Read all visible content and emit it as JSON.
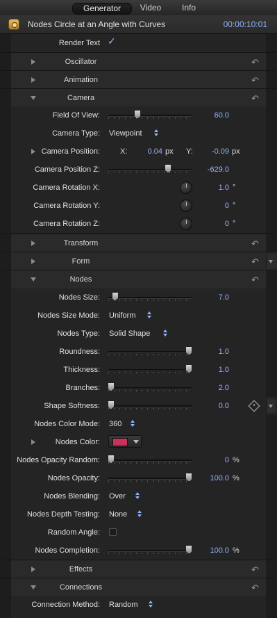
{
  "tabs": [
    {
      "label": "Generator",
      "active": true
    },
    {
      "label": "Video",
      "active": false
    },
    {
      "label": "Info",
      "active": false
    }
  ],
  "header": {
    "title": "Nodes Circle at an Angle with Curves",
    "timecode": "00:00:10:01",
    "icon": "generator-icon"
  },
  "accent_color": "#8fb4ff",
  "render_text": {
    "label": "Render Text",
    "checked": true
  },
  "groups": {
    "oscillator": "Oscillator",
    "animation": "Animation",
    "camera": "Camera",
    "transform": "Transform",
    "form": "Form",
    "nodes": "Nodes",
    "effects": "Effects",
    "connections": "Connections"
  },
  "camera": {
    "fov": {
      "label": "Field Of View:",
      "value": "60.0",
      "slider": 0.35
    },
    "type": {
      "label": "Camera Type:",
      "value": "Viewpoint"
    },
    "position": {
      "label": "Camera Position:",
      "x_label": "X:",
      "x": "0.04",
      "x_unit": "px",
      "y_label": "Y:",
      "y": "-0.09",
      "y_unit": "px"
    },
    "position_z": {
      "label": "Camera Position Z:",
      "value": "-629.0",
      "slider": 0.72
    },
    "rot_x": {
      "label": "Camera Rotation X:",
      "value": "1.0",
      "unit": "°"
    },
    "rot_y": {
      "label": "Camera Rotation Y:",
      "value": "0",
      "unit": "°"
    },
    "rot_z": {
      "label": "Camera Rotation Z:",
      "value": "0",
      "unit": "°"
    }
  },
  "nodes": {
    "size": {
      "label": "Nodes Size:",
      "value": "7.0",
      "slider": 0.08
    },
    "size_mode": {
      "label": "Nodes Size Mode:",
      "value": "Uniform"
    },
    "type": {
      "label": "Nodes Type:",
      "value": "Solid Shape"
    },
    "roundness": {
      "label": "Roundness:",
      "value": "1.0",
      "slider": 0.97
    },
    "thickness": {
      "label": "Thickness:",
      "value": "1.0",
      "slider": 0.97
    },
    "branches": {
      "label": "Branches:",
      "value": "2.0",
      "slider": 0.03
    },
    "shape_softness": {
      "label": "Shape Softness:",
      "value": "0.0",
      "slider": 0.03
    },
    "color_mode": {
      "label": "Nodes Color Mode:",
      "value": "360"
    },
    "color": {
      "label": "Nodes Color:",
      "swatch": "#c9305a"
    },
    "opacity_random": {
      "label": "Nodes Opacity Random:",
      "value": "0",
      "unit": "%",
      "slider": 0.03
    },
    "opacity": {
      "label": "Nodes Opacity:",
      "value": "100.0",
      "unit": "%",
      "slider": 0.97
    },
    "blending": {
      "label": "Nodes Blending:",
      "value": "Over"
    },
    "depth_testing": {
      "label": "Nodes Depth Testing:",
      "value": "None"
    },
    "random_angle": {
      "label": "Random Angle:",
      "checked": false
    },
    "completion": {
      "label": "Nodes Completion:",
      "value": "100.0",
      "unit": "%",
      "slider": 0.97
    }
  },
  "connections": {
    "method": {
      "label": "Connection Method:",
      "value": "Random"
    }
  }
}
